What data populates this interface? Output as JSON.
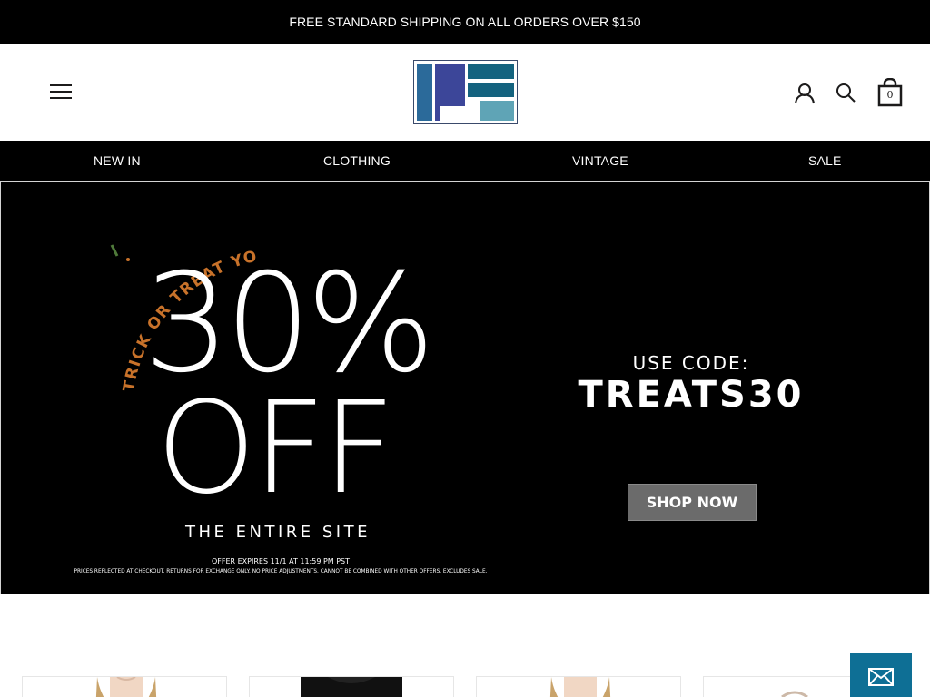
{
  "announcement": {
    "text": "FREE STANDARD SHIPPING ON ALL ORDERS OVER $150"
  },
  "header": {
    "menu_icon": "hamburger-menu-icon",
    "logo_colors": [
      "#2b6a9a",
      "#3c4699",
      "#14637f",
      "#5fa4b6"
    ],
    "account_icon": "user-account-icon",
    "search_icon": "search-icon",
    "cart_icon": "shopping-bag-icon",
    "cart_count": "0"
  },
  "nav": {
    "items": [
      {
        "label": "NEW IN"
      },
      {
        "label": "CLOTHING"
      },
      {
        "label": "VINTAGE"
      },
      {
        "label": "SALE"
      }
    ]
  },
  "hero": {
    "arc_text": "TRICK OR TREAT YOURSELF",
    "percent": "30%",
    "off": "OFF",
    "subtitle": "THE ENTIRE SITE",
    "expires": "OFFER EXPIRES 11/1 AT 11:59 PM PST",
    "fine_print": "PRICES REFLECTED AT CHECKOUT. RETURNS FOR EXCHANGE ONLY. NO PRICE ADJUSTMENTS. CANNOT BE COMBINED WITH OTHER OFFERS. EXCLUDES SALE.",
    "use_code_label": "USE CODE:",
    "code": "TREATS30",
    "cta": "SHOP NOW",
    "accent_color": "#c8722a",
    "accent_green": "#4f7a3a"
  },
  "newsletter": {
    "icon": "envelope-icon",
    "color": "#0e6f95"
  }
}
